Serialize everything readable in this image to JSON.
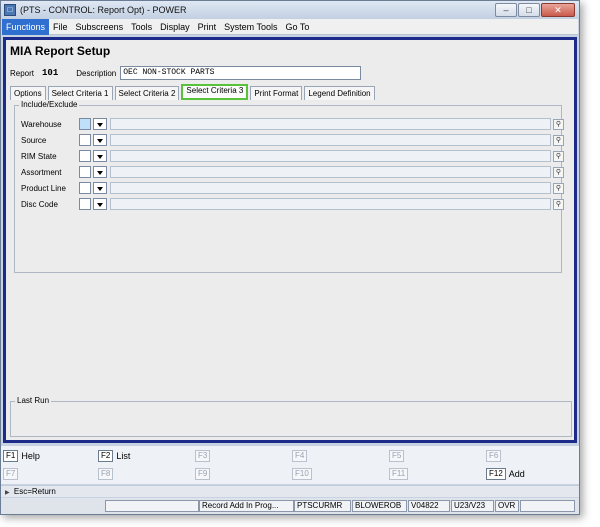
{
  "window": {
    "title": "(PTS - CONTROL: Report Opt) - POWER",
    "controls": [
      "minimize",
      "maximize",
      "close"
    ]
  },
  "menu": [
    "Functions",
    "File",
    "Subscreens",
    "Tools",
    "Display",
    "Print",
    "System Tools",
    "Go To"
  ],
  "form": {
    "title": "MIA Report Setup",
    "report_label": "Report",
    "report_number": "101",
    "description_label": "Description",
    "description_value": "OEC NON-STOCK PARTS"
  },
  "tabs": [
    "Options",
    "Select Criteria 1",
    "Select Criteria 2",
    "Select Criteria 3",
    "Print Format",
    "Legend Definition"
  ],
  "selected_tab": "Select Criteria 3",
  "include_exclude": {
    "label": "Include/Exclude",
    "rows": [
      {
        "label": "Warehouse"
      },
      {
        "label": "Source"
      },
      {
        "label": "RIM State"
      },
      {
        "label": "Assortment"
      },
      {
        "label": "Product Line"
      },
      {
        "label": "Disc Code"
      }
    ]
  },
  "last_run": {
    "label": "Last Run"
  },
  "function_keys": {
    "row1": [
      {
        "key": "F1",
        "label": "Help",
        "active": true
      },
      {
        "key": "F2",
        "label": "List",
        "active": true
      },
      {
        "key": "F3",
        "label": "",
        "active": false
      },
      {
        "key": "F4",
        "label": "",
        "active": false
      },
      {
        "key": "F5",
        "label": "",
        "active": false
      },
      {
        "key": "F6",
        "label": "",
        "active": false
      }
    ],
    "row2": [
      {
        "key": "F7",
        "label": "",
        "active": false
      },
      {
        "key": "F8",
        "label": "",
        "active": false
      },
      {
        "key": "F9",
        "label": "",
        "active": false
      },
      {
        "key": "F10",
        "label": "",
        "active": false
      },
      {
        "key": "F11",
        "label": "",
        "active": false
      },
      {
        "key": "F12",
        "label": "Add",
        "active": true
      }
    ]
  },
  "esc_hint": "Esc=Return",
  "status": {
    "mode": "Record Add In Prog...",
    "program": "PTSCURMR",
    "user": "BLOWEROB",
    "version": "V04822",
    "release": "U23/V23",
    "insert_mode": "OVR"
  },
  "colors": {
    "form_border": "#1c2a8a",
    "selected_tab_outline": "#57c23a",
    "menu_active": "#2f6fd0"
  }
}
